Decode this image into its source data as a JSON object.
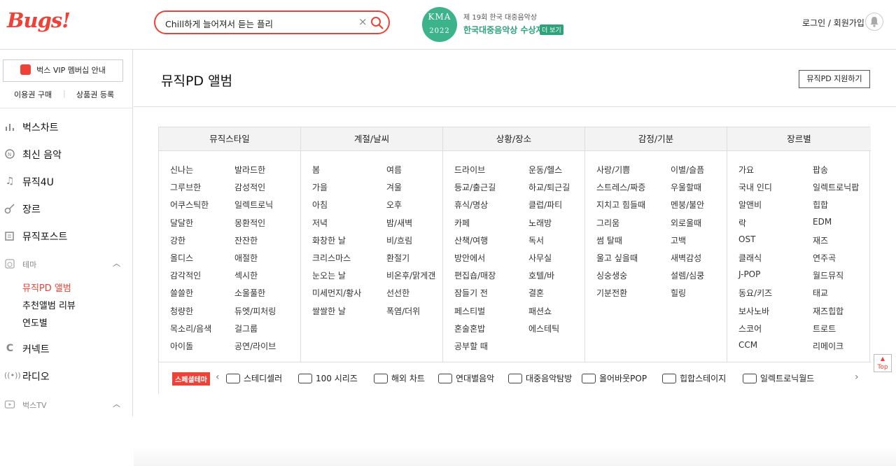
{
  "header": {
    "logo": "Bugs!",
    "search_value": "Chill하게 늘어져서 듣는 플리",
    "clear_glyph": "×",
    "kma": {
      "circle_top": "KMA",
      "circle_year": "2022",
      "subtitle": "제 19회 한국 대중음악상",
      "title": "한국대중음악상 수상자",
      "more": "더 보기"
    },
    "login": "로그인 / 회원가입",
    "icons": [
      "search-icon",
      "bell-icon"
    ]
  },
  "sidebar": {
    "vip": "벅스 VIP 멤버십 안내",
    "purchase": "이용권 구매",
    "register": "상품권 등록",
    "menu": [
      {
        "label": "벅스차트",
        "icon": "chart-icon"
      },
      {
        "label": "최신 음악",
        "icon": "new-icon"
      },
      {
        "label": "뮤직4U",
        "icon": "note-icon"
      },
      {
        "label": "장르",
        "icon": "guitar-icon"
      },
      {
        "label": "뮤직포스트",
        "icon": "post-icon"
      }
    ],
    "theme": {
      "label": "테마",
      "items": [
        "뮤직PD 앨범",
        "추천앨범 리뷰",
        "연도별"
      ]
    },
    "connect": "커넥트",
    "radio": "라디오",
    "tv": "벅스TV"
  },
  "main": {
    "title": "뮤직PD 앨범",
    "apply_button": "뮤직PD 지원하기",
    "columns": [
      {
        "header": "뮤직스타일",
        "left": [
          "신나는",
          "그루브한",
          "어쿠스틱한",
          "달달한",
          "강한",
          "올디스",
          "감각적인",
          "쓸쓸한",
          "청량한",
          "목소리/음색",
          "아이돌"
        ],
        "right": [
          "발라드한",
          "감성적인",
          "일렉트로닉",
          "몽환적인",
          "잔잔한",
          "애절한",
          "섹시한",
          "소울풀한",
          "듀엣/피처링",
          "걸그룹",
          "공연/라이브"
        ]
      },
      {
        "header": "계절/날씨",
        "left": [
          "봄",
          "가을",
          "아침",
          "저녁",
          "화창한 날",
          "크리스마스",
          "눈오는 날",
          "미세먼지/황사",
          "쌀쌀한 날"
        ],
        "right": [
          "여름",
          "겨울",
          "오후",
          "밤/새벽",
          "비/흐림",
          "환절기",
          "비온후/맑게갠",
          "선선한",
          "폭염/더위"
        ]
      },
      {
        "header": "상황/장소",
        "left": [
          "드라이브",
          "등교/출근길",
          "휴식/명상",
          "카페",
          "산책/여행",
          "방안에서",
          "편집숍/매장",
          "잠들기 전",
          "페스티벌",
          "혼술혼밥",
          "공부할 때"
        ],
        "right": [
          "운동/헬스",
          "하교/퇴근길",
          "클럽/파티",
          "노래방",
          "독서",
          "사무실",
          "호텔/바",
          "결혼",
          "패션쇼",
          "에스테틱"
        ]
      },
      {
        "header": "감정/기분",
        "left": [
          "사랑/기쁨",
          "스트레스/짜증",
          "지치고 힘들때",
          "그리움",
          "썸 탈때",
          "울고 싶을때",
          "싱숭생숭",
          "기분전환"
        ],
        "right": [
          "이별/슬픔",
          "우울할때",
          "멘붕/불안",
          "외로울때",
          "고백",
          "새벽감성",
          "설렘/심쿵",
          "힐링"
        ]
      },
      {
        "header": "장르별",
        "left": [
          "가요",
          "국내 인디",
          "알앤비",
          "락",
          "OST",
          "클래식",
          "J-POP",
          "동요/키즈",
          "보사노바",
          "스코어",
          "CCM"
        ],
        "right": [
          "팝송",
          "일렉트로닉팝",
          "힙합",
          "EDM",
          "재즈",
          "연주곡",
          "월드뮤직",
          "태교",
          "재즈힙합",
          "트로트",
          "리메이크"
        ]
      }
    ],
    "special": {
      "badge": "스페셜테마",
      "items": [
        "스테디셀러",
        "100 시리즈",
        "해외 차트",
        "연대별음악",
        "대중음악탐방",
        "올어바웃POP",
        "힙합스테이지",
        "일렉트로닉월드"
      ]
    },
    "top": "Top"
  }
}
